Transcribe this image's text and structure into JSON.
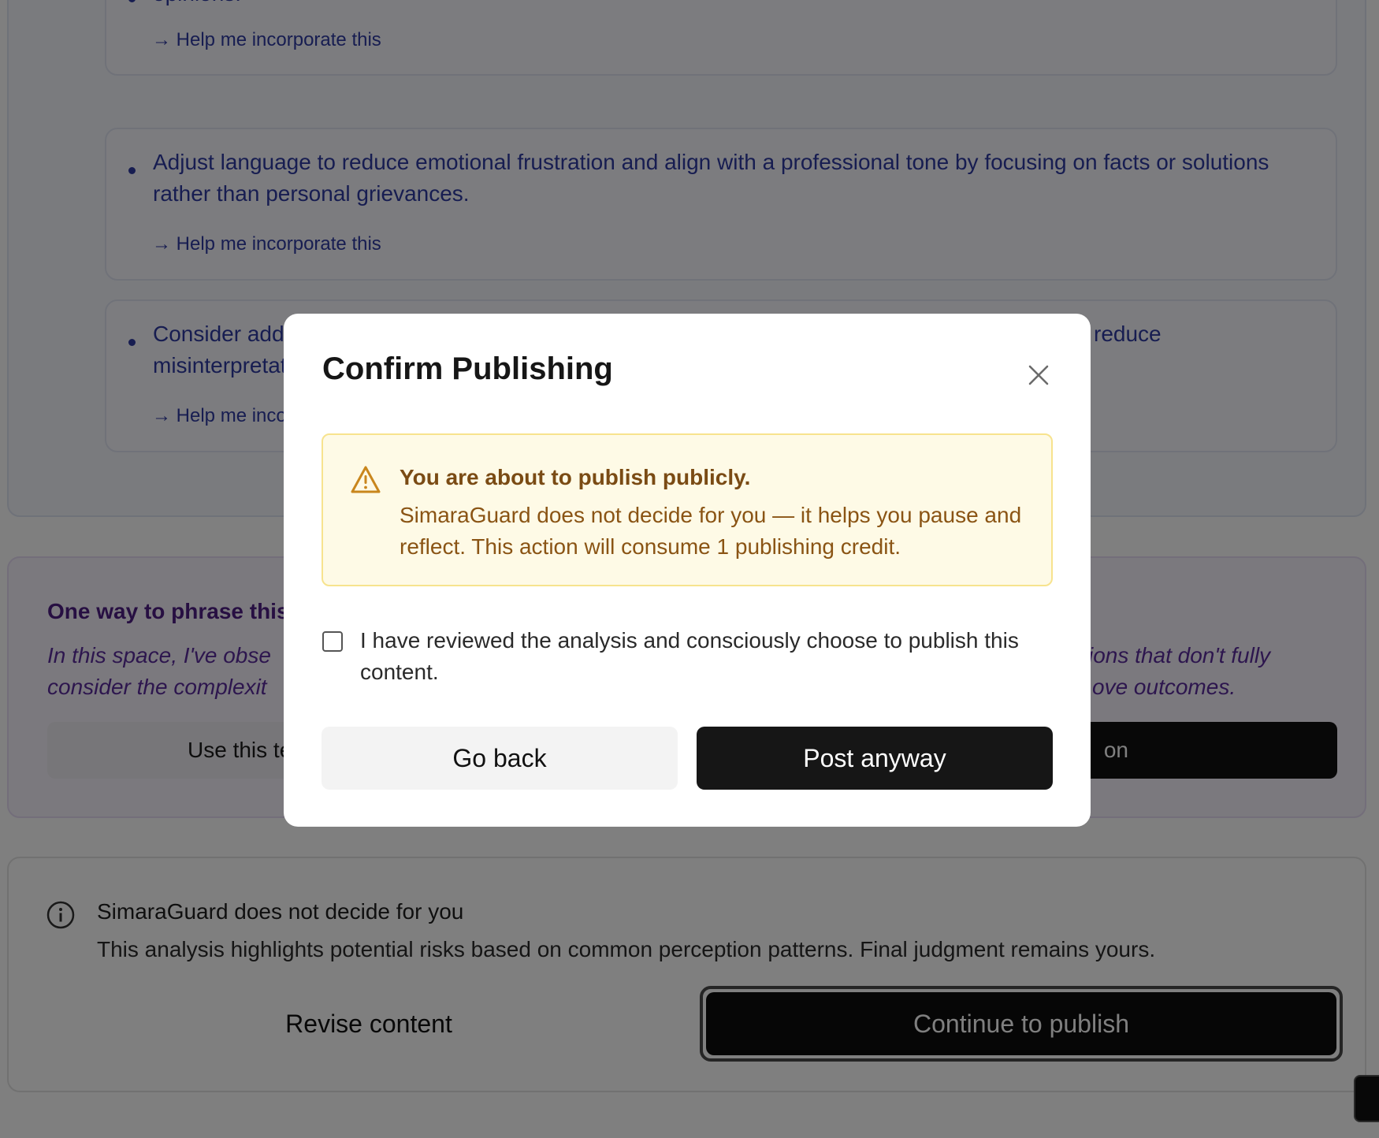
{
  "suggestions": {
    "items": [
      {
        "text": "opinions.",
        "link": "→ Help me incorporate this"
      },
      {
        "text": "Adjust language to reduce emotional frustration and align with a professional tone by focusing on facts or solutions rather than personal grievances.",
        "link": "→ Help me incorporate this"
      },
      {
        "text": "Consider add… reduce misinterpretat…",
        "link": "→ Help me inco…"
      }
    ],
    "third_visible_left": "Consider add",
    "third_visible_right": "reduce",
    "third_visible_line2": "misinterpretat",
    "third_link_visible": "→ Help me inco"
  },
  "phrase_panel": {
    "title": "One way to phrase this",
    "text_left": "In this space, I've obse",
    "text_right": "ions that don't fully",
    "text_left2": "consider the complexit",
    "text_right2": "ove outcomes.",
    "use_button": "Use this te",
    "black_button_visible": "on"
  },
  "info_panel": {
    "title": "SimaraGuard does not decide for you",
    "text": "This analysis highlights potential risks based on common perception patterns. Final judgment remains yours.",
    "revise_button": "Revise content",
    "continue_button": "Continue to publish"
  },
  "modal": {
    "title": "Confirm Publishing",
    "close_icon": "close-icon",
    "warning": {
      "icon": "warning-triangle-icon",
      "title": "You are about to publish publicly.",
      "text": "SimaraGuard does not decide for you — it helps you pause and reflect. This action will consume 1 publishing credit."
    },
    "checkbox_label": "I have reviewed the analysis and consciously choose to publish this content.",
    "checkbox_checked": false,
    "go_back_button": "Go back",
    "post_button": "Post anyway"
  },
  "colors": {
    "suggestion_text": "#2f3aa3",
    "phrase_text": "#5b2d9c",
    "warning_text": "#8a5414",
    "warning_bg": "#fefae6",
    "overlay": "rgba(0,0,0,0.5)"
  }
}
